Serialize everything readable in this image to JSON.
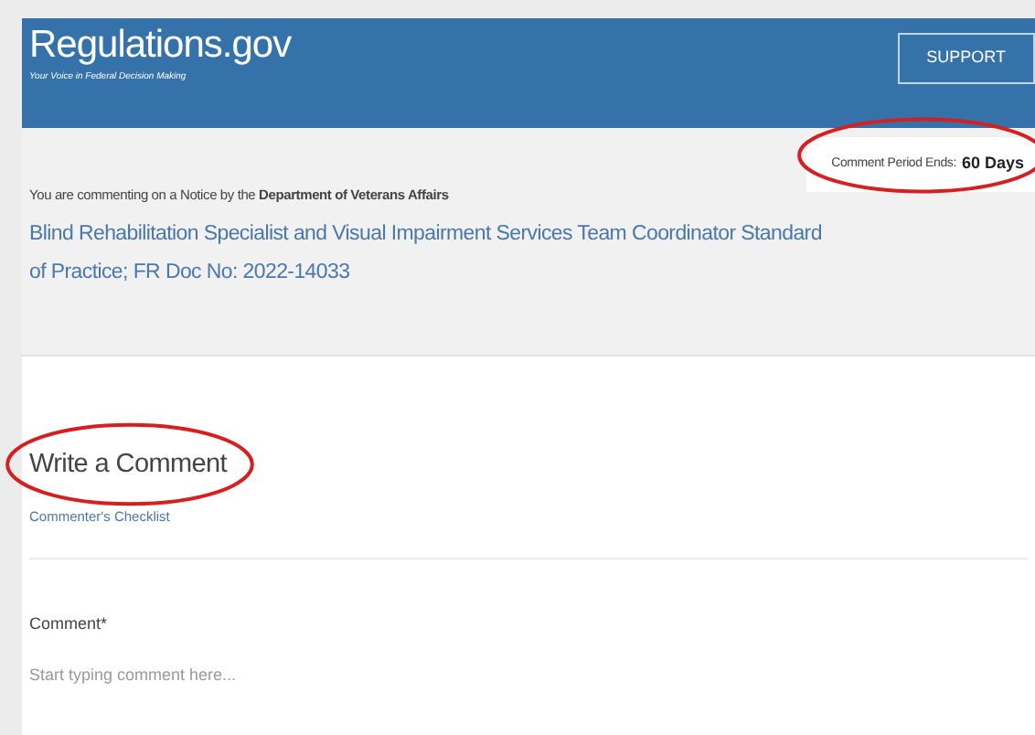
{
  "header": {
    "logo": "Regulations.gov",
    "tagline": "Your Voice in Federal Decision Making",
    "support_button": "SUPPORT"
  },
  "notice": {
    "intro": "You are commenting on a Notice by the **Department of Veterans Affairs**",
    "document_title": "Blind Rehabilitation Specialist and Visual Impairment Services Team Coordinator Standard of Practice; FR Doc No: 2022-14033",
    "comment_period": {
      "label": "Comment Period Ends:",
      "value": "60 Days",
      "circled": true
    }
  },
  "comment_form": {
    "heading": "Write a Comment",
    "heading_circled": true,
    "checklist_link": "Commenter's Checklist",
    "field_label": "Comment*",
    "placeholder": "Start typing comment here..."
  }
}
